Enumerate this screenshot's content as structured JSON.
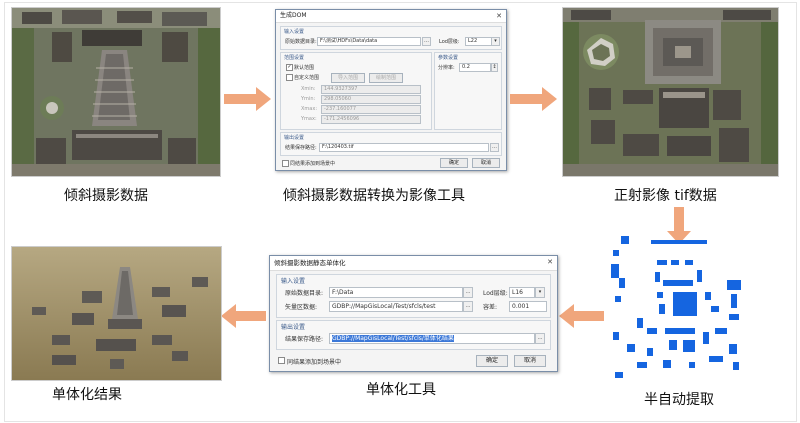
{
  "captions": {
    "oblique_data": "倾斜摄影数据",
    "convert_tool": "倾斜摄影数据转换为影像工具",
    "ortho_tif": "正射影像 tif数据",
    "monomer_result": "单体化结果",
    "monomer_tool": "单体化工具",
    "semi_auto": "半自动提取"
  },
  "dom_dialog": {
    "title": "生成DOM",
    "close": "✕",
    "input_group": "输入设置",
    "data_dir_label": "原始数据目录:",
    "data_dir_value": "F:\\测试\\HDFs\\Data\\data",
    "lod_label": "Lod层级:",
    "lod_value": "L22",
    "range_group": "范围设置",
    "default_range_label": "默认范围",
    "custom_range_label": "自定义范围",
    "import_range_button": "导入范围",
    "draw_range_button": "绘制范围",
    "xmin_label": "Xmin:",
    "xmin_value": "144.9327397",
    "ymin_label": "Ymin:",
    "ymin_value": "298.05060",
    "xmax_label": "Xmax:",
    "xmax_value": "-237.160077",
    "ymax_label": "Ymax:",
    "ymax_value": "-171.2456096",
    "param_group": "参数设置",
    "resolution_label": "分辨率:",
    "resolution_value": "0.2",
    "output_group": "输出设置",
    "output_path_label": "结果保存路径:",
    "output_path_value": "F:\\120403.tif",
    "add_scene_label": "同结果添加到场景中",
    "ok_button": "确定",
    "cancel_button": "取消"
  },
  "mono_dialog": {
    "title": "倾斜摄影数据静态单体化",
    "close": "✕",
    "input_group": "输入设置",
    "data_dir_label": "原始数据目录:",
    "data_dir_value": "F:\\Data",
    "vector_label": "矢量区数据:",
    "vector_value": "GDBP://MapGisLocal/Test/sfcls/test",
    "lod_label": "Lod层级:",
    "lod_value": "L16",
    "tolerance_label": "容差:",
    "tolerance_value": "0.001",
    "output_group": "输出设置",
    "output_path_label": "结果保存路径:",
    "output_path_value": "GDBP://MapGisLocal/Test/sfcls/单体化结果",
    "add_scene_label": "同结果添加到场景中",
    "ok_button": "确定",
    "cancel_button": "取消"
  },
  "colors": {
    "arrow": "#f0a67c",
    "arrow_down": "#f0a67c",
    "extract_blue": "#1565e0"
  }
}
